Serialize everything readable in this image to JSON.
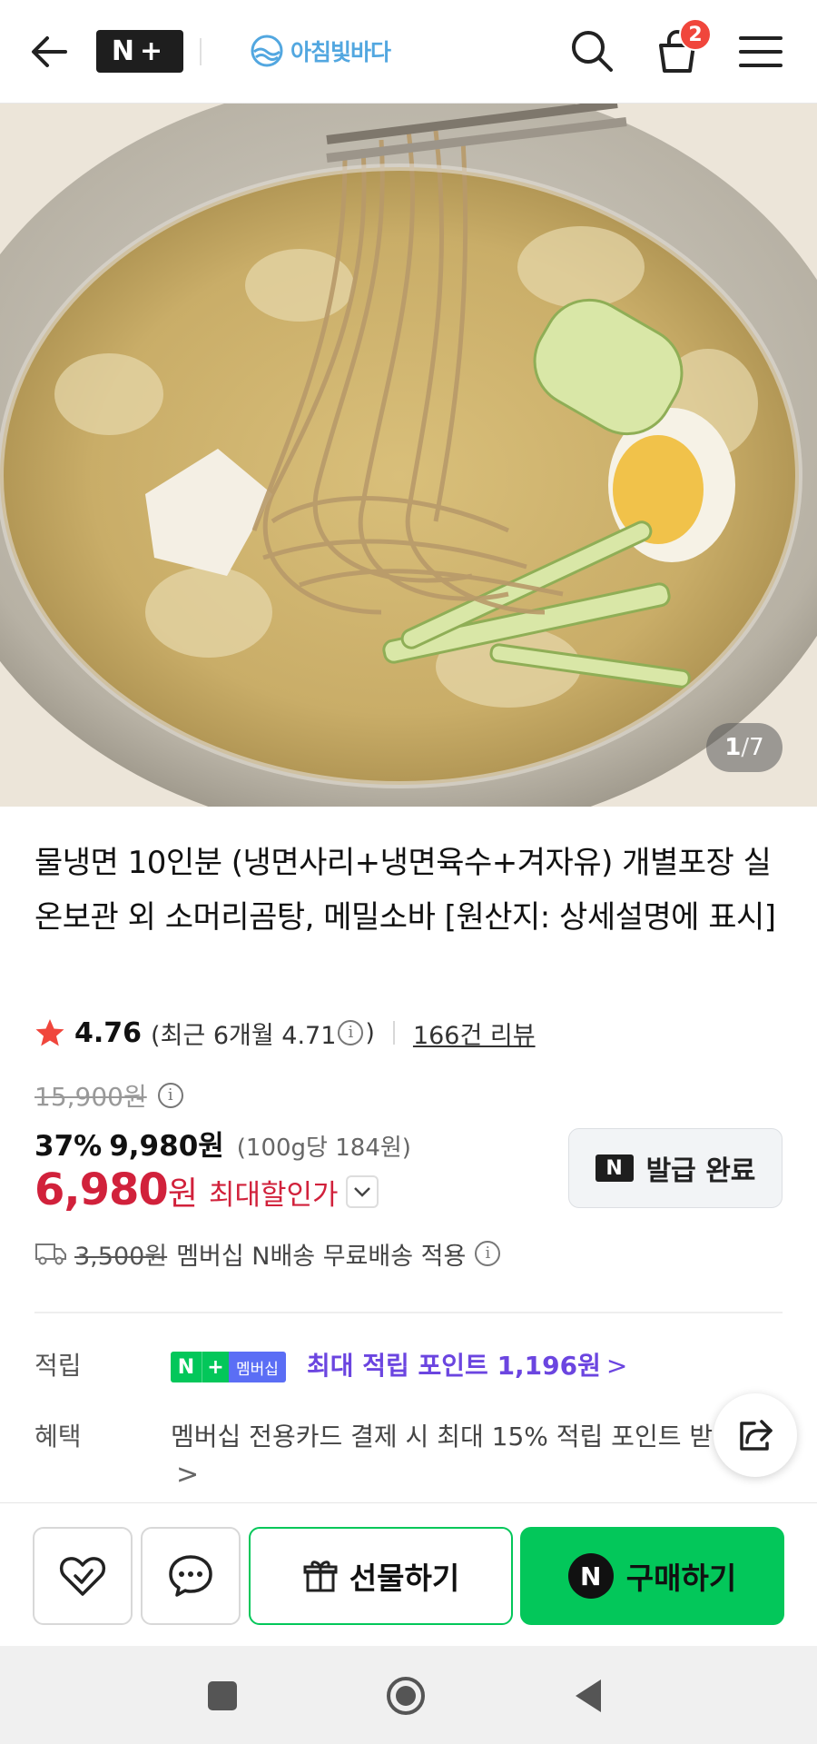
{
  "header": {
    "brand_badge": "N+",
    "store_name": "아침빛바다",
    "cart_count": "2",
    "icons": [
      "arrow-left-icon",
      "search-icon",
      "shopping-bag-icon",
      "hamburger-menu-icon"
    ]
  },
  "image_gallery": {
    "current": "1",
    "separator": "/",
    "total": "7"
  },
  "product": {
    "title": "물냉면 10인분 (냉면사리+냉면육수+겨자유) 개별포장 실온보관 외 소머리곰탕, 메밀소바 [원산지: 상세설명에 표시]",
    "rating": "4.76",
    "recent_rating": "(최근 6개월 4.71",
    "recent_rating_close": ")",
    "review_count": "166건 리뷰"
  },
  "price": {
    "original": "15,900원",
    "discount_percent": "37%",
    "sale_price": "9,980원",
    "unit_price": "(100g당 184원)",
    "max_discount_number": "6,980",
    "max_discount_won": "원",
    "max_discount_label": "최대할인가",
    "coupon_label": "발급 완료",
    "coupon_icon": "N"
  },
  "shipping": {
    "fee": "3,500원",
    "note": "멤버십 N배송 무료배송 적용"
  },
  "points": {
    "label": "적립",
    "badge_n": "N",
    "badge_plus": "+",
    "badge_text": "멤버십",
    "link": "최대 적립 포인트 1,196원",
    "arrow": ">"
  },
  "benefits": {
    "label": "혜택",
    "text": "멤버십 전용카드 결제 시 최대 15% 적립 포인트 받",
    "more": ">"
  },
  "actions": {
    "gift_label": "선물하기",
    "buy_label": "구매하기",
    "buy_icon": "N"
  },
  "colors": {
    "accent_green": "#03c75a",
    "sale_red": "#d1213b",
    "points_purple": "#6b45e0",
    "badge_red": "#f0463c"
  }
}
